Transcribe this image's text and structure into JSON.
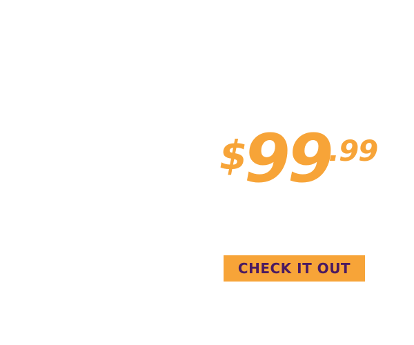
{
  "price": {
    "currency_symbol": "$",
    "dollars": "99",
    "cents": ".99"
  },
  "cta": {
    "label": "CHECK IT OUT"
  },
  "colors": {
    "accent": "#f7a438",
    "button_text": "#4a1a61",
    "background": "#ffffff"
  }
}
